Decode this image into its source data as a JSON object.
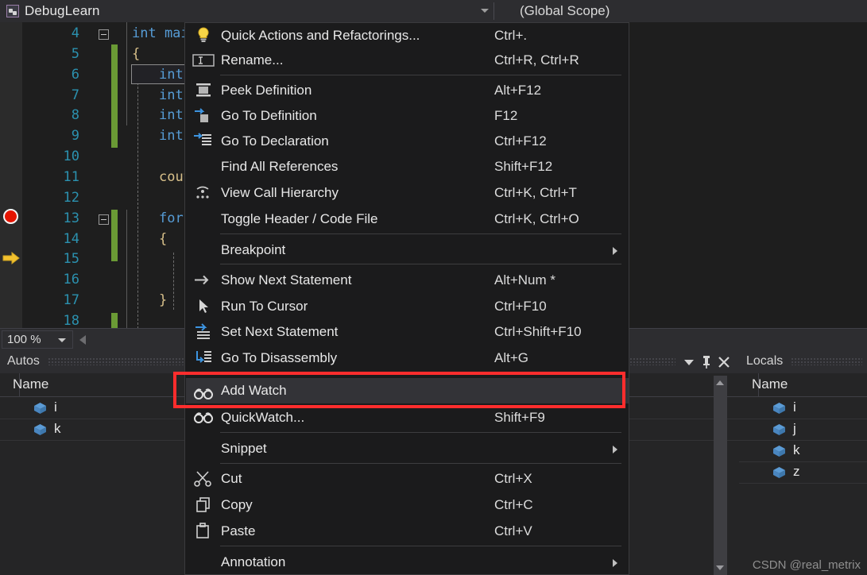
{
  "titlebar": {
    "project_name": "DebugLearn",
    "project_icon": "puzzle-icon",
    "scope_text": "(Global Scope)",
    "dropdown_icon": "chevron-down-icon"
  },
  "editor": {
    "zoom_level": "100 %",
    "lines": [
      {
        "number": "4",
        "code": "int main",
        "indent": 0,
        "fold": true,
        "changebar": false,
        "dashed": false
      },
      {
        "number": "5",
        "code": "{",
        "indent": 1,
        "fold": false,
        "changebar": true,
        "dashed": false
      },
      {
        "number": "6",
        "code": "int",
        "indent": 2,
        "fold": false,
        "changebar": true,
        "dashed": true
      },
      {
        "number": "7",
        "code": "int",
        "indent": 2,
        "fold": false,
        "changebar": true,
        "dashed": true
      },
      {
        "number": "8",
        "code": "int",
        "indent": 2,
        "fold": false,
        "changebar": true,
        "dashed": true
      },
      {
        "number": "9",
        "code": "int",
        "indent": 2,
        "fold": false,
        "changebar": true,
        "dashed": true
      },
      {
        "number": "10",
        "code": "",
        "indent": 2,
        "fold": false,
        "changebar": true,
        "dashed": true
      },
      {
        "number": "11",
        "code": "cout",
        "indent": 2,
        "fold": false,
        "changebar": false,
        "dashed": true
      },
      {
        "number": "12",
        "code": "",
        "indent": 2,
        "fold": false,
        "changebar": false,
        "dashed": true
      },
      {
        "number": "13",
        "code": "for",
        "indent": 2,
        "fold": true,
        "changebar": true,
        "dashed": true
      },
      {
        "number": "14",
        "code": "{",
        "indent": 2,
        "fold": false,
        "changebar": true,
        "dashed": true
      },
      {
        "number": "15",
        "code": "",
        "indent": 3,
        "fold": false,
        "changebar": true,
        "dashed": true
      },
      {
        "number": "16",
        "code": "",
        "indent": 3,
        "fold": false,
        "changebar": false,
        "dashed": true
      },
      {
        "number": "17",
        "code": "}",
        "indent": 2,
        "fold": false,
        "changebar": false,
        "dashed": true
      },
      {
        "number": "18",
        "code": "",
        "indent": 2,
        "fold": false,
        "changebar": true,
        "dashed": true
      }
    ],
    "breakpoint_line": "13",
    "current_statement_line": "15",
    "breakpoint_icon": "breakpoint-icon",
    "current_statement_icon": "yellow-arrow-icon"
  },
  "context_menu": {
    "items": [
      {
        "label": "Quick Actions and Refactorings...",
        "shortcut": "Ctrl+.",
        "icon": "lightbulb-icon",
        "submenu": false,
        "highlighted": false,
        "sep_after": false
      },
      {
        "label": "Rename...",
        "shortcut": "Ctrl+R, Ctrl+R",
        "icon": "rename-icon",
        "submenu": false,
        "highlighted": false,
        "sep_after": true
      },
      {
        "label": "Peek Definition",
        "shortcut": "Alt+F12",
        "icon": "peek-definition-icon",
        "submenu": false,
        "highlighted": false,
        "sep_after": false
      },
      {
        "label": "Go To Definition",
        "shortcut": "F12",
        "icon": "go-to-definition-icon",
        "submenu": false,
        "highlighted": false,
        "sep_after": false
      },
      {
        "label": "Go To Declaration",
        "shortcut": "Ctrl+F12",
        "icon": "go-to-declaration-icon",
        "submenu": false,
        "highlighted": false,
        "sep_after": false
      },
      {
        "label": "Find All References",
        "shortcut": "Shift+F12",
        "icon": "",
        "submenu": false,
        "highlighted": false,
        "sep_after": false
      },
      {
        "label": "View Call Hierarchy",
        "shortcut": "Ctrl+K, Ctrl+T",
        "icon": "call-hierarchy-icon",
        "submenu": false,
        "highlighted": false,
        "sep_after": false
      },
      {
        "label": "Toggle Header / Code File",
        "shortcut": "Ctrl+K, Ctrl+O",
        "icon": "",
        "submenu": false,
        "highlighted": false,
        "sep_after": true
      },
      {
        "label": "Breakpoint",
        "shortcut": "",
        "icon": "",
        "submenu": true,
        "highlighted": false,
        "sep_after": true
      },
      {
        "label": "Show Next Statement",
        "shortcut": "Alt+Num *",
        "icon": "arrow-right-icon",
        "submenu": false,
        "highlighted": false,
        "sep_after": false
      },
      {
        "label": "Run To Cursor",
        "shortcut": "Ctrl+F10",
        "icon": "cursor-arrow-icon",
        "submenu": false,
        "highlighted": false,
        "sep_after": false
      },
      {
        "label": "Set Next Statement",
        "shortcut": "Ctrl+Shift+F10",
        "icon": "set-next-statement-icon",
        "submenu": false,
        "highlighted": false,
        "sep_after": false
      },
      {
        "label": "Go To Disassembly",
        "shortcut": "Alt+G",
        "icon": "disassembly-icon",
        "submenu": false,
        "highlighted": false,
        "sep_after": true
      },
      {
        "label": "Add Watch",
        "shortcut": "",
        "icon": "watch-glasses-icon",
        "submenu": false,
        "highlighted": true,
        "sep_after": false
      },
      {
        "label": "QuickWatch...",
        "shortcut": "Shift+F9",
        "icon": "watch-glasses-icon",
        "submenu": false,
        "highlighted": false,
        "sep_after": true
      },
      {
        "label": "Snippet",
        "shortcut": "",
        "icon": "",
        "submenu": true,
        "highlighted": false,
        "sep_after": true
      },
      {
        "label": "Cut",
        "shortcut": "Ctrl+X",
        "icon": "scissors-icon",
        "submenu": false,
        "highlighted": false,
        "sep_after": false
      },
      {
        "label": "Copy",
        "shortcut": "Ctrl+C",
        "icon": "copy-icon",
        "submenu": false,
        "highlighted": false,
        "sep_after": false
      },
      {
        "label": "Paste",
        "shortcut": "Ctrl+V",
        "icon": "paste-icon",
        "submenu": false,
        "highlighted": false,
        "sep_after": true
      },
      {
        "label": "Annotation",
        "shortcut": "",
        "icon": "",
        "submenu": true,
        "highlighted": false,
        "sep_after": false
      }
    ],
    "highlight_color": "#ff2d2d"
  },
  "autos_panel": {
    "title": "Autos",
    "column_name": "Name",
    "variables": [
      {
        "name": "i"
      },
      {
        "name": "k"
      }
    ]
  },
  "locals_panel": {
    "title": "Locals",
    "column_name": "Name",
    "variables": [
      {
        "name": "i"
      },
      {
        "name": "j"
      },
      {
        "name": "k"
      },
      {
        "name": "z"
      }
    ]
  },
  "panel_toolbar": {
    "dropdown_icon": "chevron-down-icon",
    "pin_icon": "pin-icon",
    "close_icon": "close-icon"
  },
  "watermark": "CSDN @real_metrix"
}
